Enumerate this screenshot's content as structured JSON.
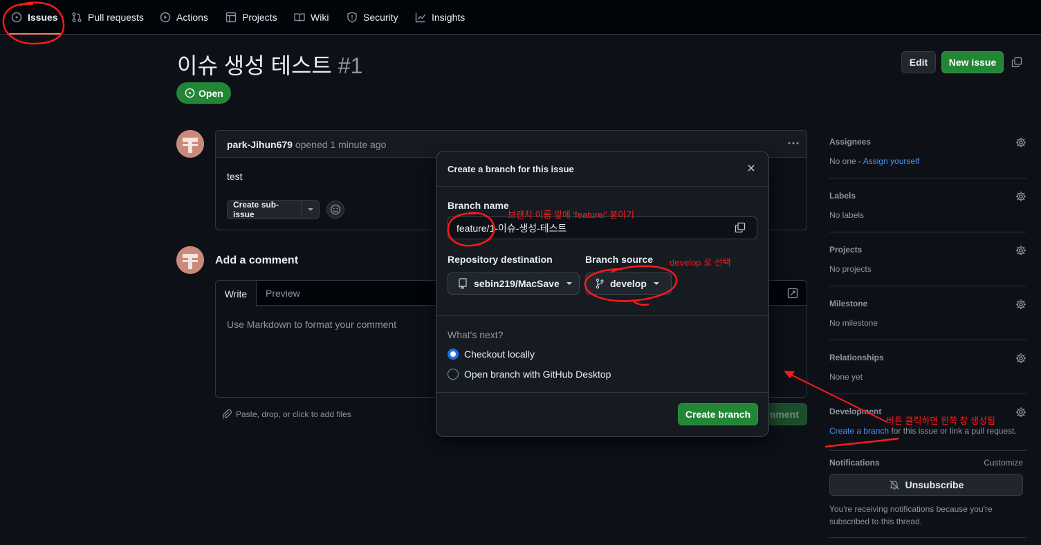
{
  "nav": {
    "items": [
      {
        "label": "Issues",
        "icon": "issue-opened-icon"
      },
      {
        "label": "Pull requests",
        "icon": "pull-request-icon"
      },
      {
        "label": "Actions",
        "icon": "play-icon"
      },
      {
        "label": "Projects",
        "icon": "table-icon"
      },
      {
        "label": "Wiki",
        "icon": "book-icon"
      },
      {
        "label": "Security",
        "icon": "shield-icon"
      },
      {
        "label": "Insights",
        "icon": "graph-icon"
      }
    ]
  },
  "issue": {
    "title": "이슈 생성 테스트",
    "number": "#1",
    "status": "Open",
    "edit_label": "Edit",
    "new_issue_label": "New issue"
  },
  "comment": {
    "author": "park-Jihun679",
    "meta": "opened 1 minute ago",
    "body": "test",
    "sub_issue_label": "Create sub-issue"
  },
  "add_comment": {
    "heading": "Add a comment",
    "tab_write": "Write",
    "tab_preview": "Preview",
    "placeholder": "Use Markdown to format your comment",
    "attach_hint": "Paste, drop, or click to add files",
    "submit_label_partial": "mment"
  },
  "sidebar": {
    "assignees": {
      "title": "Assignees",
      "text": "No one - ",
      "link": "Assign yourself"
    },
    "labels": {
      "title": "Labels",
      "text": "No labels"
    },
    "projects": {
      "title": "Projects",
      "text": "No projects"
    },
    "milestone": {
      "title": "Milestone",
      "text": "No milestone"
    },
    "relationships": {
      "title": "Relationships",
      "text": "None yet"
    },
    "development": {
      "title": "Development",
      "link": "Create a branch",
      "text": " for this issue or link a pull request."
    },
    "notifications": {
      "title": "Notifications",
      "customize": "Customize",
      "button": "Unsubscribe",
      "text": "You're receiving notifications because you're subscribed to this thread."
    }
  },
  "modal": {
    "title": "Create a branch for this issue",
    "branch_name_label": "Branch name",
    "branch_prefix": "feature/",
    "branch_rest": "1-이슈-생성-테스트",
    "repo_label": "Repository destination",
    "repo_value": "sebin219/MacSave",
    "source_label": "Branch source",
    "source_value": "develop",
    "whats_next": "What's next?",
    "option_local": "Checkout locally",
    "option_desktop": "Open branch with GitHub Desktop",
    "create_label": "Create branch"
  },
  "annotations": {
    "branch_note": "브랜치 이름 앞에 'feature/' 붙이기",
    "source_note": "develop 로 선택",
    "button_note": "버튼 클릭하면 왼쪽 창 생성됨"
  },
  "colors": {
    "accent_green": "#238636",
    "link": "#4493f8",
    "annotation_red": "#ff1a1a"
  }
}
